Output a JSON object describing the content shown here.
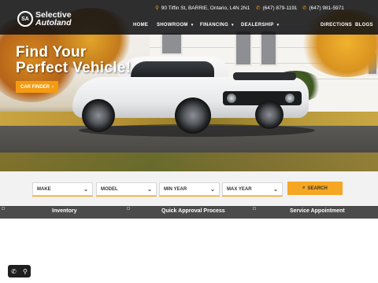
{
  "header": {
    "logo": {
      "line1": "Selective",
      "line2": "Autoland",
      "badge": "SA"
    },
    "address": "90 Tiffin St, BARRIE, Ontario, L4N 2N1",
    "phone1": "(647) 879-1191",
    "phone2": "(647) 981-5971",
    "nav": {
      "home": "HOME",
      "showroom": "SHOWROOM",
      "financing": "FINANCING",
      "dealership": "DEALERSHIP",
      "directions": "DIRECTIONS",
      "blogs": "BLOGS"
    }
  },
  "hero": {
    "headline_line1": "Find Your",
    "headline_line2": "Perfect Vehicle!",
    "cta_label": "CAR FINDER"
  },
  "search": {
    "make": "MAKE",
    "model": "MODEL",
    "min_year": "MIN YEAR",
    "max_year": "MAX YEAR",
    "button_label": "SEARCH"
  },
  "features": {
    "inventory": "Inventory",
    "approval": "Quick Approval Process",
    "service": "Service Appointment"
  },
  "icons": {
    "pin": "map-pin-icon",
    "phone": "phone-icon",
    "caret": "caret-down-icon",
    "chevron": "chevron-down-icon",
    "search": "search-icon",
    "location": "location-icon"
  },
  "colors": {
    "accent": "#f39c12",
    "header_bg": "#121214",
    "feature_bar": "#4b4b4b",
    "search_bar": "#f2f2f2"
  }
}
